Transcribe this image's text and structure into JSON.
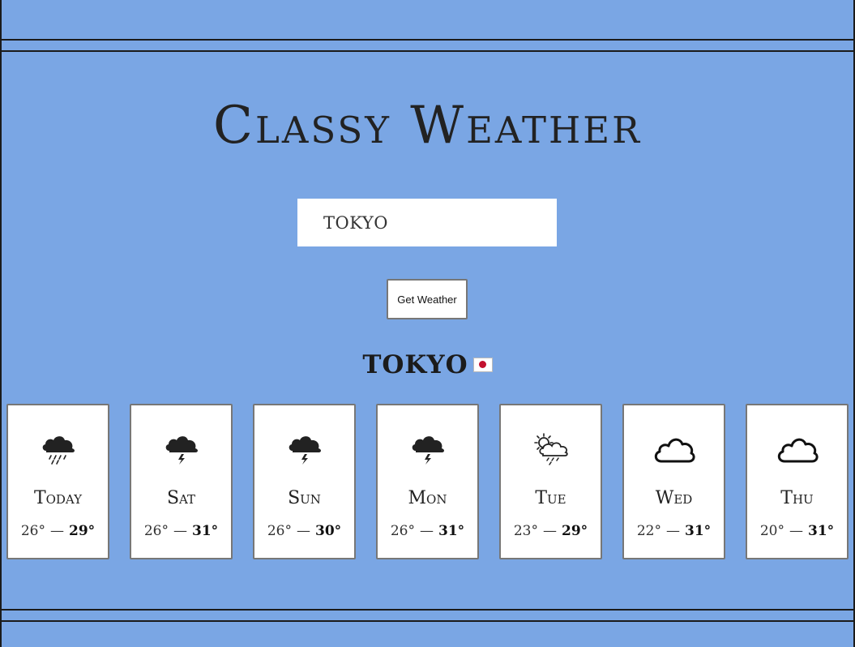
{
  "app": {
    "title": "Classy Weather"
  },
  "search": {
    "value": "TOKYO"
  },
  "button": {
    "label": "Get Weather"
  },
  "location": {
    "name": "TOKYO",
    "flag_icon": "japan-flag-icon"
  },
  "forecast": [
    {
      "day": "Today",
      "min": "26°",
      "sep": "—",
      "max": "29°",
      "icon": "rain-cloud-icon"
    },
    {
      "day": "Sat",
      "min": "26°",
      "sep": "—",
      "max": "31°",
      "icon": "thunder-cloud-icon"
    },
    {
      "day": "Sun",
      "min": "26°",
      "sep": "—",
      "max": "30°",
      "icon": "thunder-cloud-icon"
    },
    {
      "day": "Mon",
      "min": "26°",
      "sep": "—",
      "max": "31°",
      "icon": "thunder-cloud-icon"
    },
    {
      "day": "Tue",
      "min": "23°",
      "sep": "—",
      "max": "29°",
      "icon": "sun-behind-rain-cloud-icon"
    },
    {
      "day": "Wed",
      "min": "22°",
      "sep": "—",
      "max": "31°",
      "icon": "cloud-icon"
    },
    {
      "day": "Thu",
      "min": "20°",
      "sep": "—",
      "max": "31°",
      "icon": "cloud-icon"
    }
  ],
  "colors": {
    "background": "#7aa6e4",
    "frame": "#1b1b1b",
    "card_border": "#777777"
  }
}
